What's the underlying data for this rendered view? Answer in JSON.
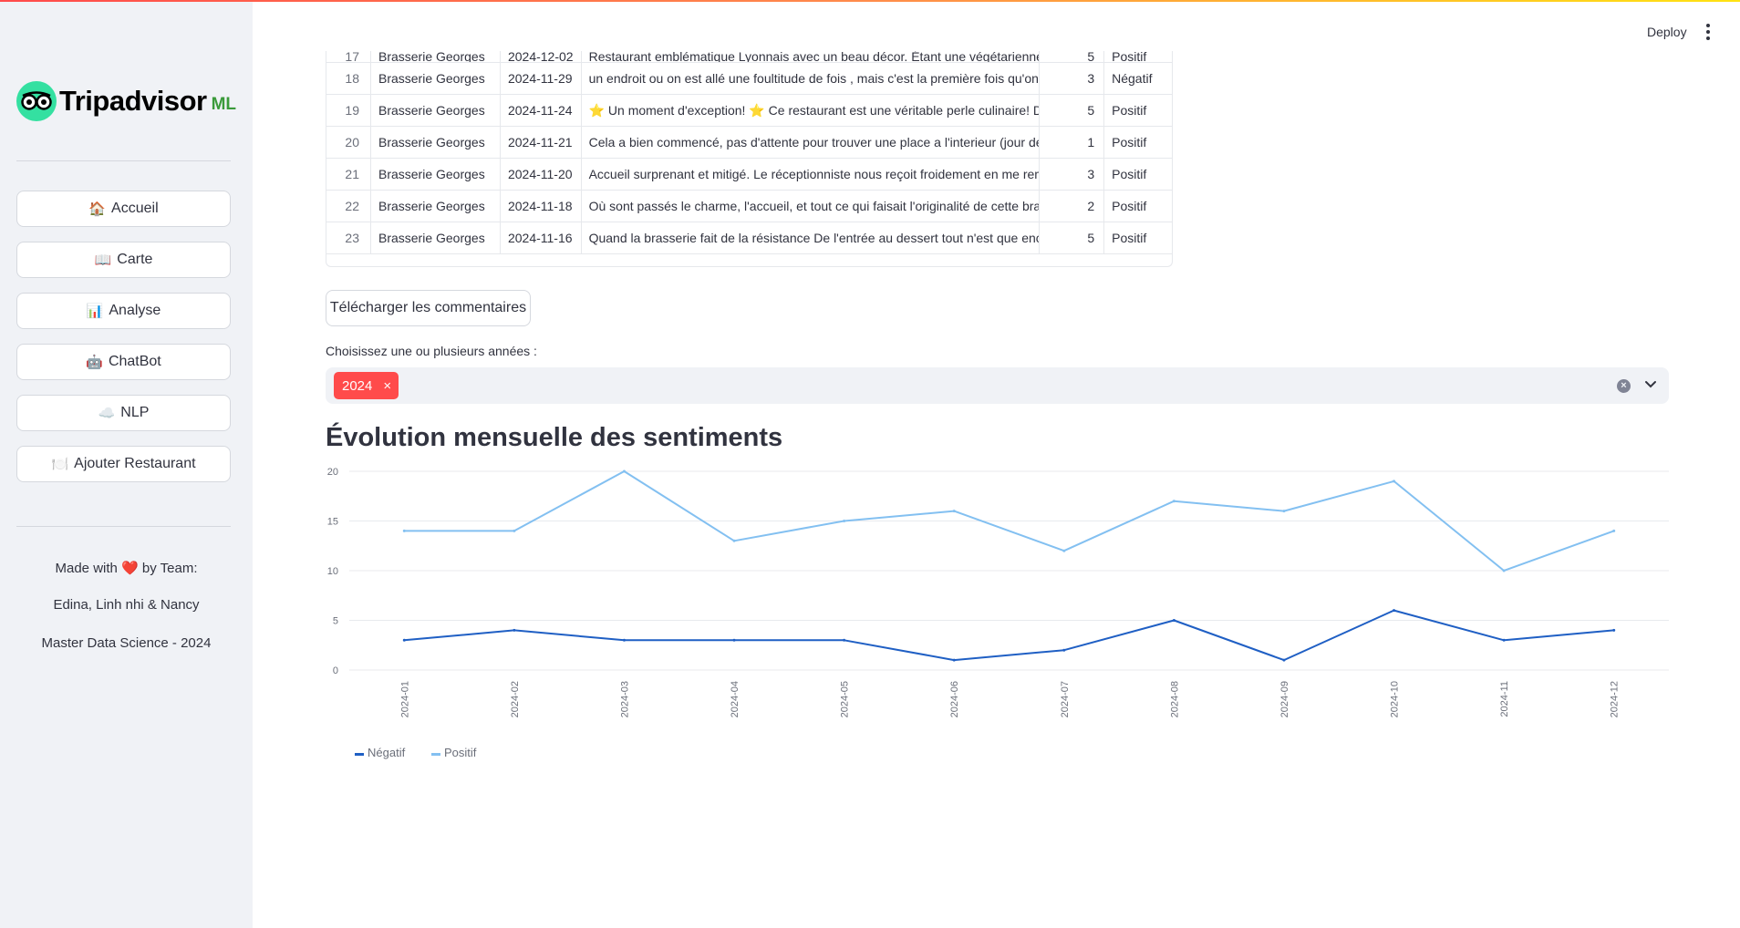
{
  "sidebar": {
    "logo_text": "Tripadvisor",
    "logo_suffix": "ML",
    "nav": [
      {
        "emoji": "🏠",
        "label": "Accueil"
      },
      {
        "emoji": "📖",
        "label": "Carte"
      },
      {
        "emoji": "📊",
        "label": "Analyse"
      },
      {
        "emoji": "🤖",
        "label": "ChatBot"
      },
      {
        "emoji": "☁️",
        "label": "NLP"
      },
      {
        "emoji": "🍽️",
        "label": "Ajouter Restaurant"
      }
    ],
    "made_with_prefix": "Made with",
    "heart": "❤️",
    "made_with_suffix": "by Team:",
    "team": "Edina, Linh nhi & Nancy",
    "course": "Master Data Science - 2024"
  },
  "header": {
    "deploy_label": "Deploy"
  },
  "table": {
    "partial_row": {
      "index": "17",
      "name": "Brasserie Georges",
      "date": "2024-12-02",
      "comment": "Restaurant emblématique Lyonnais avec un beau décor. Étant une végétarienne, installé",
      "note": "5",
      "sentiment": "Positif"
    },
    "rows": [
      {
        "index": "18",
        "name": "Brasserie Georges",
        "date": "2024-11-29",
        "comment": "un endroit ou on est allé une foultitude de fois , mais c'est la première fois qu'on est c",
        "note": "3",
        "sentiment": "Négatif"
      },
      {
        "index": "19",
        "name": "Brasserie Georges",
        "date": "2024-11-24",
        "comment": "⭐ Un moment d'exception! ⭐ Ce restaurant est une véritable perle culinaire! Dès m",
        "note": "5",
        "sentiment": "Positif"
      },
      {
        "index": "20",
        "name": "Brasserie Georges",
        "date": "2024-11-21",
        "comment": "Cela a bien commencé, pas d'attente pour trouver une place a l'interieur (jour de gra",
        "note": "1",
        "sentiment": "Positif"
      },
      {
        "index": "21",
        "name": "Brasserie Georges",
        "date": "2024-11-20",
        "comment": "Accueil surprenant et mitigé. Le réceptionniste nous reçoit froidement en me remetta",
        "note": "3",
        "sentiment": "Positif"
      },
      {
        "index": "22",
        "name": "Brasserie Georges",
        "date": "2024-11-18",
        "comment": "Où sont passés le charme, l'accueil, et tout ce qui faisait l'originalité de cette brasseri",
        "note": "2",
        "sentiment": "Positif"
      },
      {
        "index": "23",
        "name": "Brasserie Georges",
        "date": "2024-11-16",
        "comment": "Quand la brasserie fait de la résistance  De l'entrée au dessert tout n'est que enchante",
        "note": "5",
        "sentiment": "Positif"
      }
    ]
  },
  "download_label": "Télécharger les commentaires",
  "year_select": {
    "label": "Choisissez une ou plusieurs années :",
    "selected": [
      "2024"
    ],
    "remove_glyph": "×"
  },
  "chart_title": "Évolution mensuelle des sentiments",
  "chart_data": {
    "type": "line",
    "x": [
      "2024-01",
      "2024-02",
      "2024-03",
      "2024-04",
      "2024-05",
      "2024-06",
      "2024-07",
      "2024-08",
      "2024-09",
      "2024-10",
      "2024-11",
      "2024-12"
    ],
    "series": [
      {
        "name": "Négatif",
        "color": "#1f5fc4",
        "values": [
          3,
          4,
          3,
          3,
          3,
          1,
          2,
          5,
          1,
          6,
          3,
          4
        ]
      },
      {
        "name": "Positif",
        "color": "#83c0f1",
        "values": [
          14,
          14,
          20,
          13,
          15,
          16,
          12,
          17,
          16,
          19,
          10,
          14
        ]
      }
    ],
    "yticks": [
      "20",
      "15",
      "10",
      "5",
      "0"
    ],
    "ylim": [
      0,
      20
    ],
    "grid": true,
    "legend": "bottom-left"
  }
}
